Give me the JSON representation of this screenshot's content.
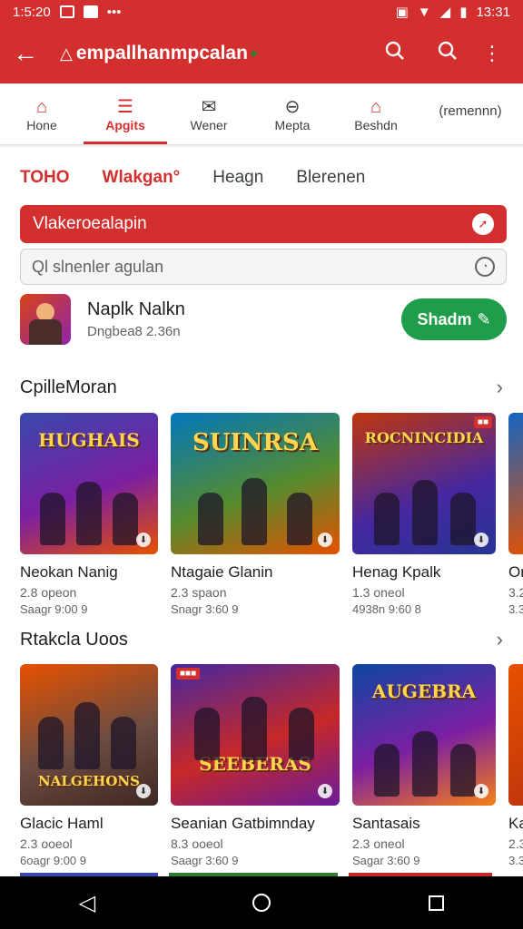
{
  "status_bar": {
    "time_left": "1:5:20",
    "time_right": "13:31"
  },
  "app_bar": {
    "title": "empallhanmpcalan"
  },
  "tabs": [
    {
      "label": "Hone"
    },
    {
      "label": "Apgits"
    },
    {
      "label": "Wener"
    },
    {
      "label": "Mepta"
    },
    {
      "label": "Beshdn"
    },
    {
      "label": "(remennn)"
    }
  ],
  "chips": [
    "TOHO",
    "Wlakgan°",
    "Heagn",
    "Blerenen"
  ],
  "banner": {
    "text": "Vlakeroealapin"
  },
  "search": {
    "placeholder": "Ql slnenler agulan"
  },
  "featured": {
    "name": "Naplk Nalkn",
    "subtitle": "Dngbea8 2.36n",
    "button": "Shadm"
  },
  "sections": [
    {
      "title": "CpilleMoran",
      "items": [
        {
          "name": "Neokan Nanig",
          "size": "2.8 opeon",
          "meta": "Saagr 9:00 9",
          "art": "HUGHAIS"
        },
        {
          "name": "Ntagaie Glanin",
          "size": "2.3 spaon",
          "meta": "Snagr 3:60 9",
          "art": "SUINRSA"
        },
        {
          "name": "Henag Kpalk",
          "size": "1.3 oneol",
          "meta": "4938n 9:60 8",
          "art": "ROCNINCIDIA"
        },
        {
          "name": "On",
          "size": "3.2",
          "meta": "3.3",
          "art": ""
        }
      ]
    },
    {
      "title": "Rtakcla Uoos",
      "items": [
        {
          "name": "Glacic Haml",
          "size": "2.3 ooeol",
          "meta": "6oagr 9:00 9",
          "art": "NALGEHONS"
        },
        {
          "name": "Seanian Gatbimnday",
          "size": "8.3 ooeol",
          "meta": "Saagr 3:60 9",
          "art": "SEEBERAS"
        },
        {
          "name": "Santasais",
          "size": "2.3 oneol",
          "meta": "Sagar 3:60 9",
          "art": "AUGEBRA"
        },
        {
          "name": "Ka",
          "size": "2.3",
          "meta": "3.3",
          "art": ""
        }
      ]
    }
  ]
}
